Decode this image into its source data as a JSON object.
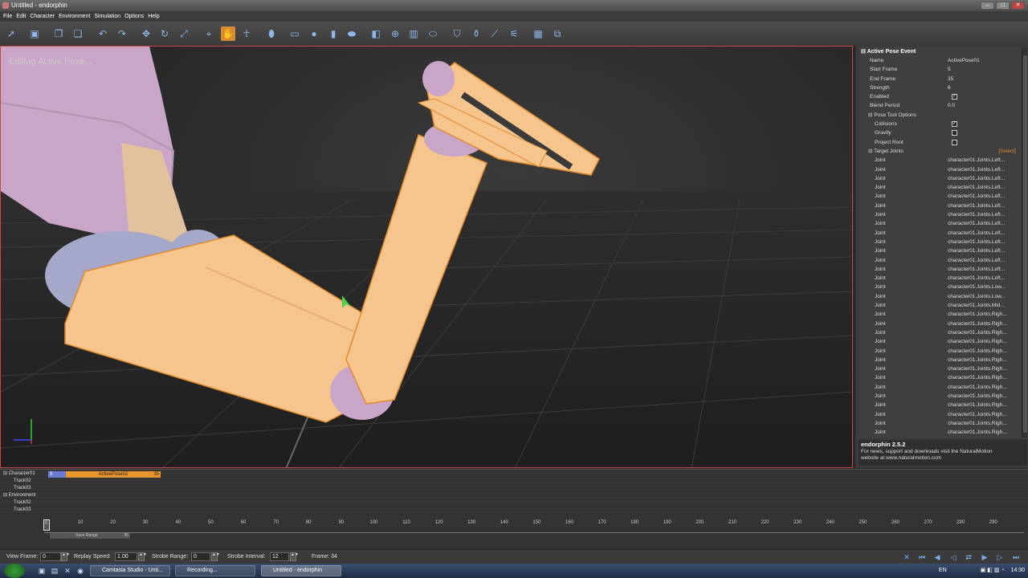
{
  "window": {
    "title": "Untitled - endorphin",
    "controls": [
      "–",
      "□",
      "✕"
    ]
  },
  "menu": [
    "File",
    "Edit",
    "Character",
    "Environment",
    "Simulation",
    "Options",
    "Help"
  ],
  "viewport": {
    "label": "Editing Active Pose..."
  },
  "properties": {
    "header": "Active Pose Event",
    "name_label": "Name",
    "name_value": "ActivePose01",
    "start_label": "Start Frame",
    "start_value": "5",
    "end_label": "End Frame",
    "end_value": "35",
    "strength_label": "Strength",
    "strength_value": "6",
    "enabled_label": "Enabled",
    "enabled_value": "✓",
    "blend_label": "Blend Period",
    "blend_value": "0.0",
    "pose_tool_label": "Pose Tool Options",
    "collisions_label": "Collisions",
    "collisions_value": "✓",
    "gravity_label": "Gravity",
    "gravity_value": "",
    "project_root_label": "Project Root",
    "project_root_value": "",
    "target_joints_label": "Target Joints",
    "select_label": "[Select]",
    "joint_label": "Joint",
    "joints": [
      "character01.Joints.Left...",
      "character01.Joints.Left...",
      "character01.Joints.Left...",
      "character01.Joints.Left...",
      "character01.Joints.Left...",
      "character01.Joints.Left...",
      "character01.Joints.Left...",
      "character01.Joints.Left...",
      "character01.Joints.Left...",
      "character01.Joints.Left...",
      "character01.Joints.Left...",
      "character01.Joints.Left...",
      "character01.Joints.Left...",
      "character01.Joints.Left...",
      "character01.Joints.Low...",
      "character01.Joints.Low...",
      "character01.Joints.Mid...",
      "character01.Joints.Righ...",
      "character01.Joints.Righ...",
      "character01.Joints.Righ...",
      "character01.Joints.Righ...",
      "character01.Joints.Righ...",
      "character01.Joints.Righ...",
      "character01.Joints.Righ...",
      "character01.Joints.Righ...",
      "character01.Joints.Righ...",
      "character01.Joints.Righ...",
      "character01.Joints.Righ...",
      "character01.Joints.Righ...",
      "character01.Joints.Righ...",
      "character01.Joints.Righ...",
      "character01.Joints.Righ..."
    ]
  },
  "about": {
    "version": "endorphin 2.5.2",
    "line1": "For news, support and downloads visit the NaturalMotion",
    "line2": "website at www.naturalmotion.com"
  },
  "tracks": {
    "character": "Character01",
    "track2": "Track02",
    "track3": "Track03",
    "environment": "Environment",
    "env_track2": "Track02",
    "env_track3": "Track03",
    "clip_start": "5",
    "clip_label": "ActivePose02",
    "clip_end": "35"
  },
  "timeline": {
    "ticks": [
      "10",
      "20",
      "30",
      "40",
      "50",
      "60",
      "70",
      "80",
      "90",
      "100",
      "110",
      "120",
      "130",
      "140",
      "150",
      "160",
      "170",
      "180",
      "190",
      "200",
      "210",
      "220",
      "230",
      "240",
      "250",
      "260",
      "270",
      "280",
      "290"
    ],
    "playhead": "0",
    "save_range": "Save Range",
    "save_end": "35"
  },
  "status": {
    "view_frame_label": "View Frame:",
    "view_frame_value": "0",
    "replay_label": "Replay Speed:",
    "replay_value": "1.00",
    "strobe_range_label": "Strobe Range:",
    "strobe_range_value": "0",
    "strobe_interval_label": "Strobe Interval:",
    "strobe_interval_value": "12",
    "frame_label": "Frame: 34"
  },
  "taskbar": {
    "tasks": [
      "Camtasia Studio - Unti...",
      "Recording...",
      "Untitled - endorphin"
    ],
    "lang": "EN",
    "clock": "14:30"
  },
  "colors": {
    "accent": "#d98b32",
    "limb_orange": "#f6c58d",
    "limb_purple": "#c9a6c8",
    "border_red": "#c44444"
  }
}
